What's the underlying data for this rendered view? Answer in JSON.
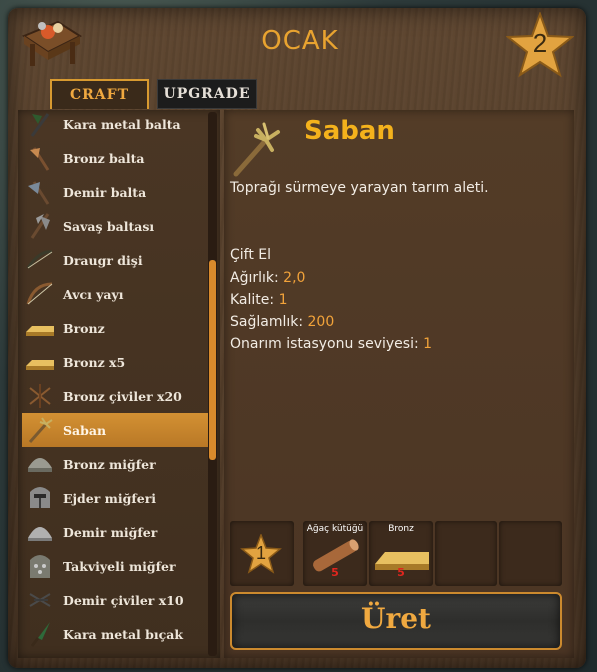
{
  "station": {
    "title": "OCAK",
    "level": "2",
    "icon": "workbench-icon"
  },
  "tabs": [
    {
      "label": "CRAFT",
      "active": true
    },
    {
      "label": "UPGRADE",
      "active": false
    }
  ],
  "recipes": [
    {
      "label": "Kara metal balta",
      "icon": "blackmetal-axe-icon"
    },
    {
      "label": "Bronz balta",
      "icon": "bronze-axe-icon"
    },
    {
      "label": "Demir balta",
      "icon": "iron-axe-icon"
    },
    {
      "label": "Savaş baltası",
      "icon": "battleaxe-icon"
    },
    {
      "label": "Draugr dişi",
      "icon": "draugr-fang-bow-icon"
    },
    {
      "label": "Avcı yayı",
      "icon": "hunter-bow-icon"
    },
    {
      "label": "Bronz",
      "icon": "bronze-bar-icon"
    },
    {
      "label": "Bronz x5",
      "icon": "bronze-bar-icon"
    },
    {
      "label": "Bronz çiviler x20",
      "icon": "bronze-nails-icon"
    },
    {
      "label": "Saban",
      "icon": "cultivator-icon",
      "selected": true
    },
    {
      "label": "Bronz miğfer",
      "icon": "bronze-helmet-icon"
    },
    {
      "label": "Ejder miğferi",
      "icon": "dragon-helmet-icon"
    },
    {
      "label": "Demir miğfer",
      "icon": "iron-helmet-icon"
    },
    {
      "label": "Takviyeli miğfer",
      "icon": "padded-helmet-icon"
    },
    {
      "label": "Demir çiviler x10",
      "icon": "iron-nails-icon"
    },
    {
      "label": "Kara metal bıçak",
      "icon": "blackmetal-knife-icon"
    }
  ],
  "selected_item": {
    "name": "Saban",
    "icon": "cultivator-icon",
    "description": "Toprağı sürmeye yarayan tarım aleti.",
    "handedness": "Çift El",
    "stats": [
      {
        "label": "Ağırlık:",
        "value": "2,0"
      },
      {
        "label": "Kalite:",
        "value": "1"
      },
      {
        "label": "Sağlamlık:",
        "value": "200"
      },
      {
        "label": "Onarım istasyonu seviyesi:",
        "value": "1"
      }
    ]
  },
  "requirements": {
    "quality": "1",
    "items": [
      {
        "name": "Ağaç kütüğü",
        "amount": "5",
        "icon": "wood-log-icon"
      },
      {
        "name": "Bronz",
        "amount": "5",
        "icon": "bronze-bar-icon"
      }
    ]
  },
  "craft_button": {
    "label": "Üret"
  },
  "colors": {
    "accent": "#f0a940",
    "title_gold": "#f4b21c",
    "selected_row": "#c8862c",
    "amount_red": "#e0261e"
  }
}
